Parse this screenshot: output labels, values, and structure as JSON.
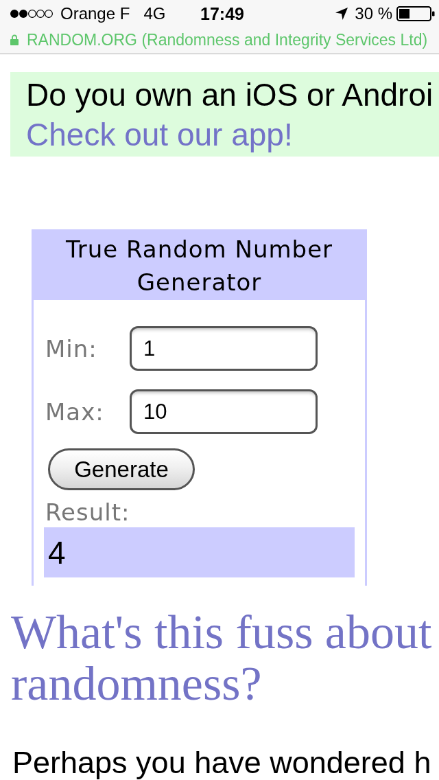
{
  "status_bar": {
    "carrier": "Orange F",
    "network": "4G",
    "time": "17:49",
    "battery": "30 %"
  },
  "address_bar": {
    "site": "RANDOM.ORG (Randomness and Integrity Services Ltd)",
    "secure": true
  },
  "banner": {
    "text": "Do you own an iOS or Androi",
    "link": "Check out our app!"
  },
  "generator": {
    "title": "True Random Number Generator",
    "fields": [
      {
        "label": "Min:",
        "value": "1"
      },
      {
        "label": "Max:",
        "value": "10"
      }
    ],
    "button": "Generate",
    "result_label": "Result:",
    "result": "4"
  },
  "article": {
    "heading": "What's this fuss about randomness?",
    "paragraph": "Perhaps you have wondered h"
  }
}
